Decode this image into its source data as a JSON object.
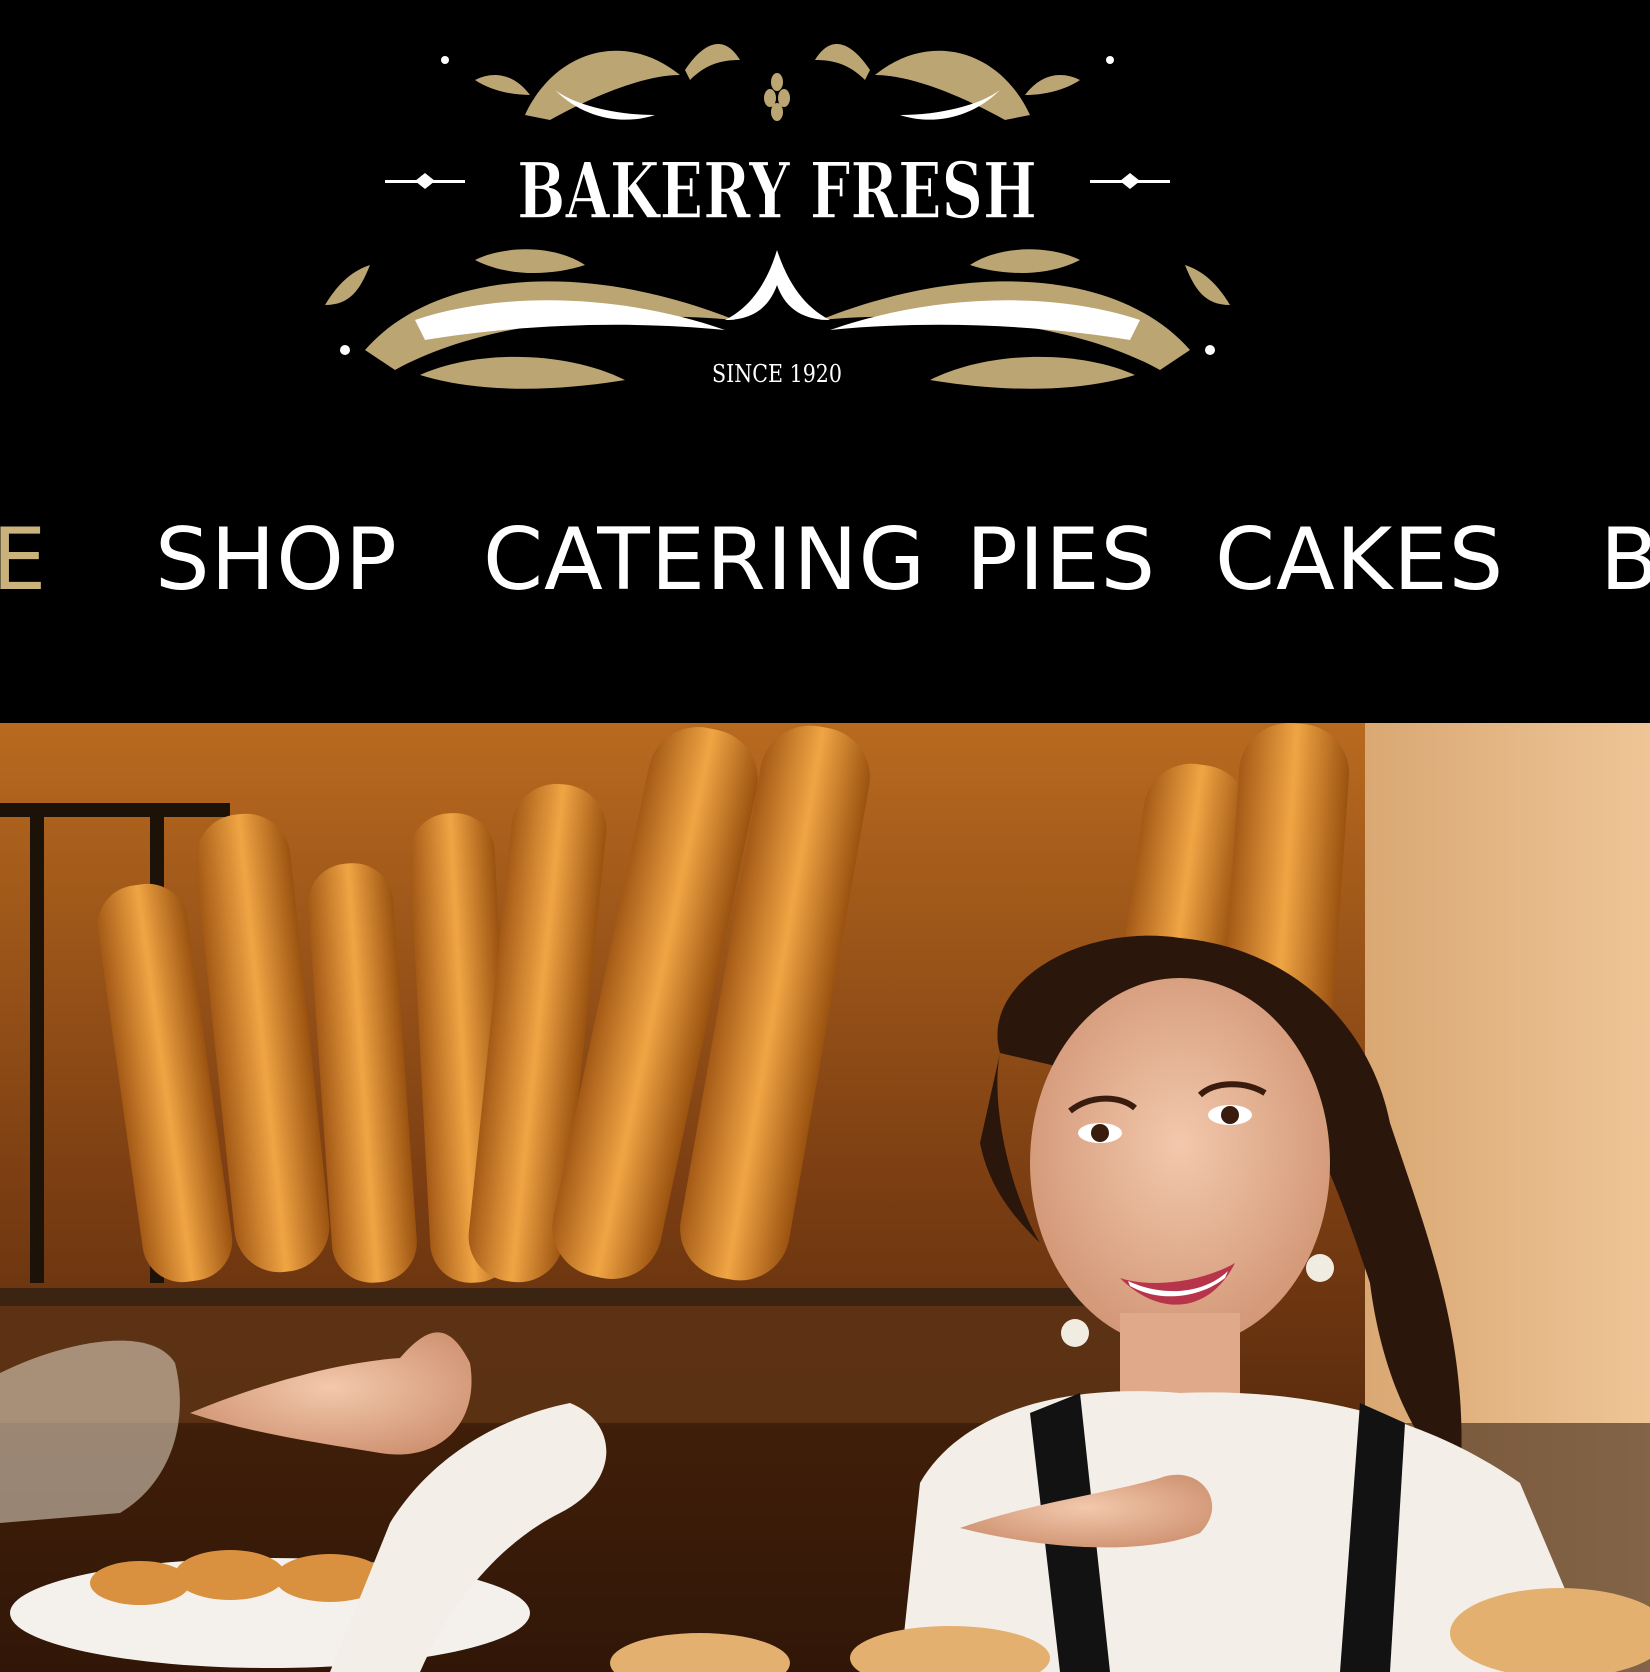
{
  "header": {
    "logo": {
      "title": "BAKERY FRESH",
      "since": "SINCE 1920"
    }
  },
  "nav": {
    "items": [
      {
        "label": "E",
        "active": true
      },
      {
        "label": "SHOP"
      },
      {
        "label": "CATERING"
      },
      {
        "label": "PIES"
      },
      {
        "label": "CAKES"
      },
      {
        "label": "B"
      }
    ]
  },
  "colors": {
    "background": "#000000",
    "nav_text": "#ffffff",
    "nav_active": "#c9b27c",
    "logo_gold": "#bba572"
  },
  "hero": {
    "image": "bakery-photo"
  }
}
